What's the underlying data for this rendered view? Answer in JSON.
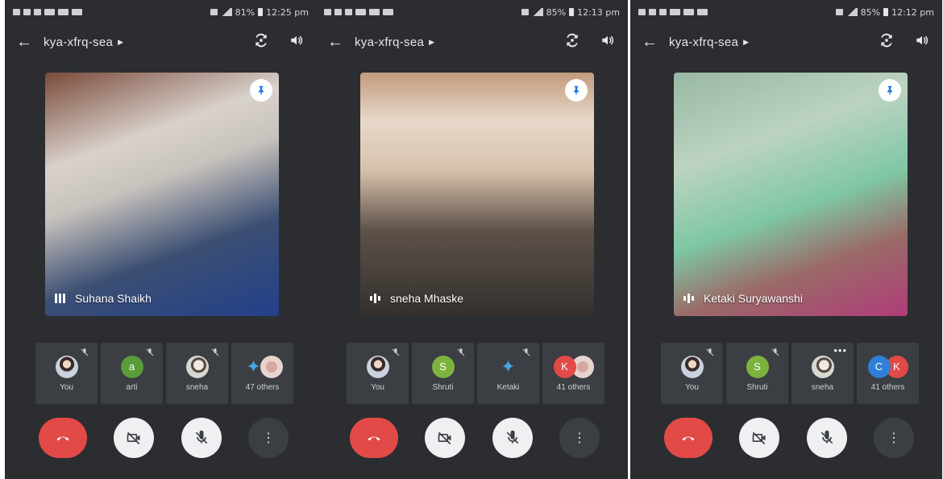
{
  "screens": [
    {
      "status": {
        "battery": "81%",
        "time": "12:25 pm"
      },
      "meeting_code": "kya-xfrq-sea",
      "speaker": {
        "name": "Suhana Shaikh",
        "bg": "linear-gradient(160deg,#7a4a3a 0%,#d9d2cc 30%,#c8c2bd 45%,#3c4f73 70%,#23408a 100%)"
      },
      "participants": [
        {
          "label": "You",
          "avatar": "photo",
          "muted": true
        },
        {
          "label": "arti",
          "avatar": "initial",
          "initial": "a",
          "color": "#5a9b3a",
          "muted": true
        },
        {
          "label": "sneha",
          "avatar": "photo2",
          "muted": true
        },
        {
          "label": "47 others",
          "avatar": "group",
          "muted": false
        }
      ]
    },
    {
      "status": {
        "battery": "85%",
        "time": "12:13 pm"
      },
      "meeting_code": "kya-xfrq-sea",
      "speaker": {
        "name": "sneha Mhaske",
        "bg": "linear-gradient(180deg,#c39a7e 0%,#e6d8c9 20%,#d8c2ad 40%,#5d5148 65%,#33302d 100%)"
      },
      "participants": [
        {
          "label": "You",
          "avatar": "photo",
          "muted": true
        },
        {
          "label": "Shruti",
          "avatar": "initial",
          "initial": "S",
          "color": "#7cb33e",
          "muted": true
        },
        {
          "label": "Ketaki",
          "avatar": "glyph",
          "muted": true
        },
        {
          "label": "41 others",
          "avatar": "pairK",
          "muted": false
        }
      ]
    },
    {
      "status": {
        "battery": "85%",
        "time": "12:12 pm"
      },
      "meeting_code": "kya-xfrq-sea",
      "speaker": {
        "name": "Ketaki Suryawanshi",
        "bg": "linear-gradient(160deg,#98b8a4 0%,#bcd3c2 30%,#7fc7a4 55%,#9a6a67 75%,#b03c7a 100%)"
      },
      "participants": [
        {
          "label": "You",
          "avatar": "photo",
          "muted": true
        },
        {
          "label": "Shruti",
          "avatar": "initial",
          "initial": "S",
          "color": "#7cb33e",
          "muted": true
        },
        {
          "label": "sneha",
          "avatar": "photo2",
          "muted": false,
          "more": true
        },
        {
          "label": "41 others",
          "avatar": "pairCK",
          "muted": false
        }
      ]
    }
  ],
  "colors": {
    "hangup": "#e24a48",
    "background": "#2b2d31",
    "tile": "#3b3e43",
    "pin": "#1a73e8"
  },
  "icons": {
    "back": "arrow-left-icon",
    "switch_camera": "switch-camera-icon",
    "speaker": "volume-icon",
    "pin": "pin-icon",
    "hangup": "phone-hangup-icon",
    "camera_off": "camera-off-icon",
    "mic_off": "mic-off-icon",
    "more": "more-vertical-icon"
  }
}
